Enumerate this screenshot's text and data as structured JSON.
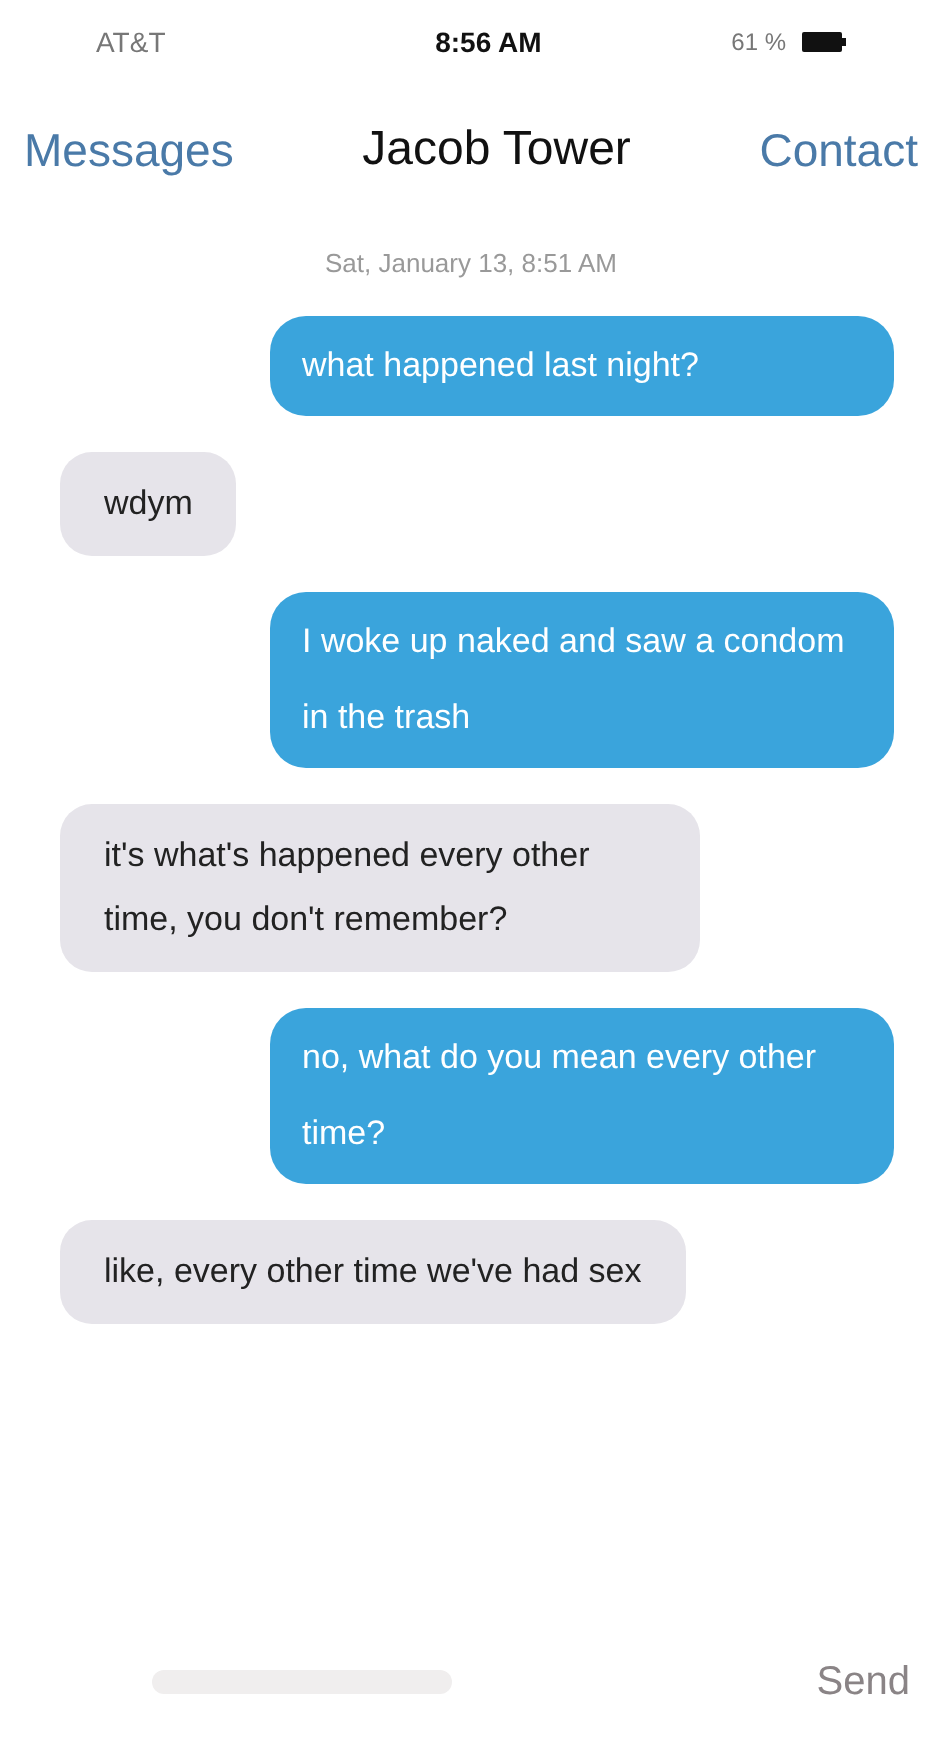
{
  "status_bar": {
    "carrier": "AT&T",
    "time": "8:56 AM",
    "battery": "61 %"
  },
  "nav": {
    "back": "Messages",
    "title": "Jacob Tower",
    "action": "Contact"
  },
  "timestamp": "Sat, January 13, 8:51 AM",
  "messages": [
    {
      "kind": "sent",
      "text": "what happened last night?"
    },
    {
      "kind": "received",
      "text": "wdym"
    },
    {
      "kind": "sent",
      "text": "I woke up naked and saw a condom in the trash"
    },
    {
      "kind": "received",
      "text": "it's what's happened every other time, you don't remember?"
    },
    {
      "kind": "sent",
      "text": "no, what do you mean every other time?"
    },
    {
      "kind": "received",
      "text": "like, every other time we've had sex"
    }
  ],
  "composer": {
    "send": "Send"
  }
}
